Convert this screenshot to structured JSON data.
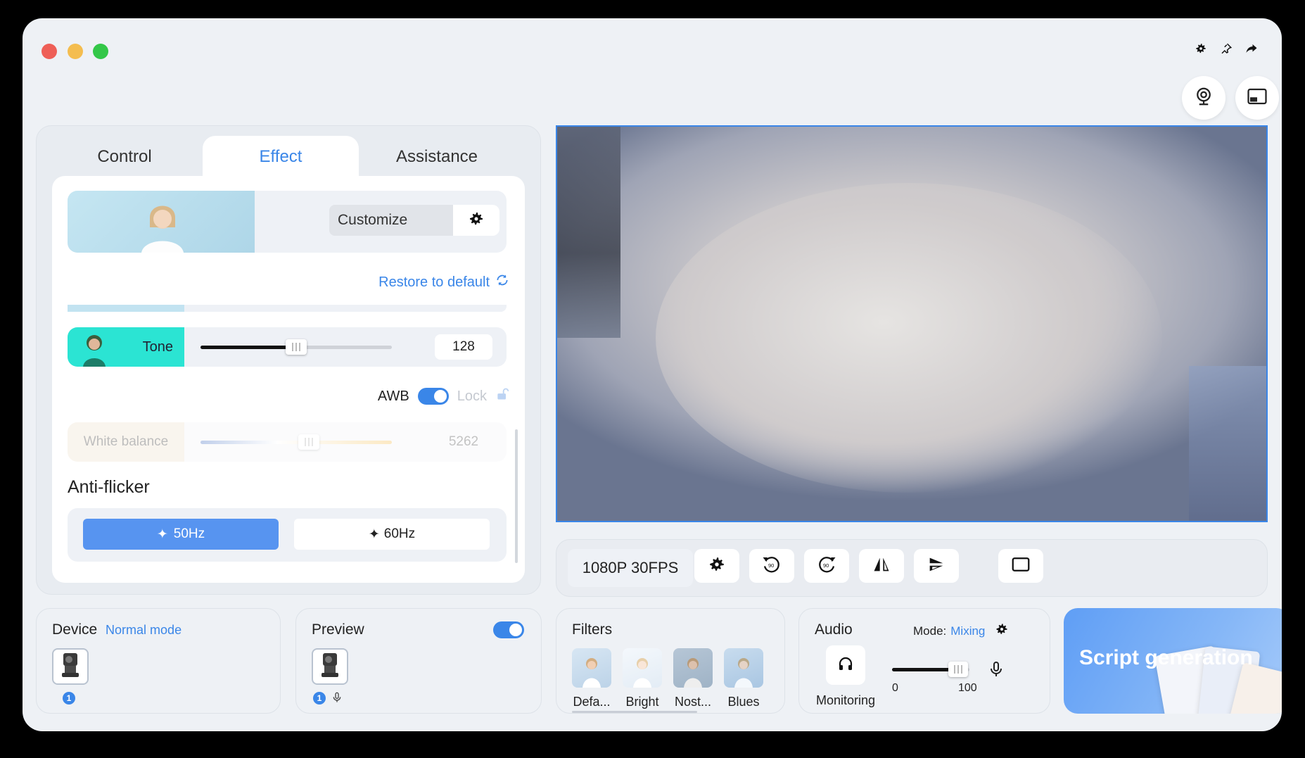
{
  "window": {
    "top_icons": [
      "gear-icon",
      "pin-icon",
      "share-icon"
    ],
    "round_buttons": [
      "webcam-icon",
      "picture-in-picture-icon"
    ]
  },
  "left_panel": {
    "tabs": [
      {
        "label": "Control",
        "active": false
      },
      {
        "label": "Effect",
        "active": true
      },
      {
        "label": "Assistance",
        "active": false
      }
    ],
    "customize_label": "Customize",
    "restore_label": "Restore to default",
    "tone": {
      "label": "Tone",
      "value": "128",
      "fraction": 0.5
    },
    "awb": {
      "label": "AWB",
      "enabled": true,
      "lock_label": "Lock"
    },
    "white_balance": {
      "label": "White balance",
      "value": "5262",
      "fraction": 0.56
    },
    "anti_flicker": {
      "title": "Anti-flicker",
      "options": [
        "50Hz",
        "60Hz"
      ],
      "selected": "50Hz"
    }
  },
  "toolbar": {
    "resolution": "1080P 30FPS",
    "buttons": [
      "settings-icon",
      "rotate-left-90-icon",
      "rotate-right-90-icon",
      "flip-horizontal-icon",
      "flip-vertical-icon",
      "frame-icon"
    ]
  },
  "device": {
    "title": "Device",
    "mode": "Normal mode",
    "badge": "1"
  },
  "preview": {
    "title": "Preview",
    "enabled": true,
    "badge": "1"
  },
  "filters": {
    "title": "Filters",
    "items": [
      "Defa...",
      "Bright",
      "Nost...",
      "Blues"
    ]
  },
  "audio": {
    "title": "Audio",
    "mode_label": "Mode:",
    "mode_value": "Mixing",
    "monitoring_label": "Monitoring",
    "volume_min": "0",
    "volume_max": "100",
    "volume_fraction": 0.85
  },
  "script": {
    "label": "Script generation"
  },
  "colors": {
    "accent": "#3a86e8",
    "tone": "#2be4d3",
    "flicker_selected": "#5794f0"
  }
}
